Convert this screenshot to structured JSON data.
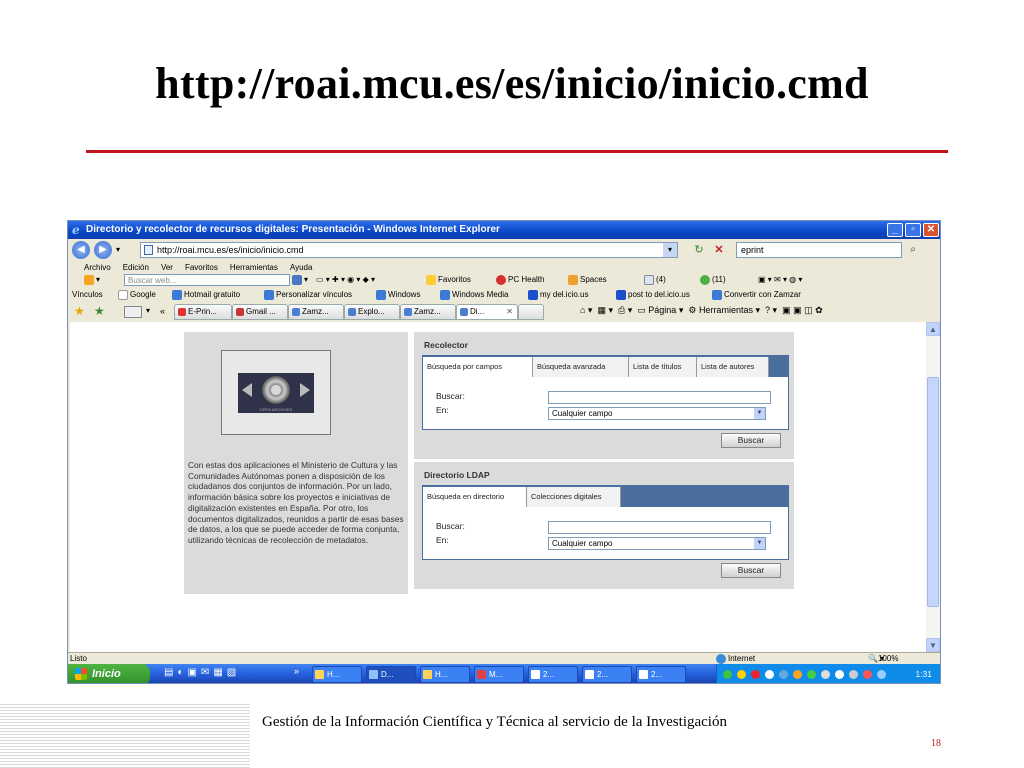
{
  "slide": {
    "title": "http://roai.mcu.es/es/inicio/inicio.cmd",
    "footer": "Gestión de la Información Científica y Técnica al servicio de la Investigación",
    "page_number": "18",
    "rule_color": "#c0161b"
  },
  "browser": {
    "window_title": "Directorio y recolector de recursos digitales: Presentación - Windows Internet Explorer",
    "address": "http://roai.mcu.es/es/inicio/inicio.cmd",
    "search_value": "eprint",
    "menu": [
      "Archivo",
      "Edición",
      "Ver",
      "Favoritos",
      "Herramientas",
      "Ayuda"
    ],
    "toolbar": {
      "search_placeholder": "Buscar web...",
      "favoritos": "Favoritos",
      "pc_health": "PC Health",
      "spaces": "Spaces",
      "mail_count": "(4)",
      "msn_count": "(11)"
    },
    "links": {
      "label": "Vínculos",
      "items": [
        "Google",
        "Hotmail gratuito",
        "Personalizar vínculos",
        "Windows",
        "Windows Media",
        "my del.icio.us",
        "post to del.icio.us",
        "Convertir con Zamzar"
      ]
    },
    "tabs": [
      "E-Prin...",
      "Gmail ...",
      "Zamz...",
      "Explo...",
      "Zamz...",
      "Di..."
    ],
    "command_bar": {
      "pagina": "Página",
      "herramientas": "Herramientas"
    },
    "status": {
      "left": "Listo",
      "zone": "Internet",
      "zoom": "100%"
    }
  },
  "page": {
    "logo_caption": "OPEN ARCHIVES",
    "intro": "Con estas dos aplicaciones el Ministerio de Cultura y las Comunidades Autónomas ponen a disposición de los ciudadanos dos conjuntos de información. Por un lado, información básica sobre los proyectos e iniciativas de digitalización existentes en España. Por otro, los documentos digitalizados, reunidos a partir de esas bases de datos, a los que se puede acceder de forma conjunta, utilizando técnicas de recolección de metadatos.",
    "recolector": {
      "title": "Recolector",
      "tabs": [
        "Búsqueda por campos",
        "Búsqueda avanzada",
        "Lista de títulos",
        "Lista de autores"
      ],
      "buscar_label": "Buscar:",
      "en_label": "En:",
      "select_value": "Cualquier campo",
      "button": "Buscar"
    },
    "ldap": {
      "title": "Directorio LDAP",
      "tabs": [
        "Búsqueda en directorio",
        "Colecciones digitales"
      ],
      "buscar_label": "Buscar:",
      "en_label": "En:",
      "select_value": "Cualquier campo",
      "button": "Buscar"
    }
  },
  "taskbar": {
    "start": "Inicio",
    "buttons": [
      "H...",
      "D...",
      "H...",
      "M...",
      "2...",
      "2...",
      "2..."
    ],
    "clock": "1:31"
  }
}
